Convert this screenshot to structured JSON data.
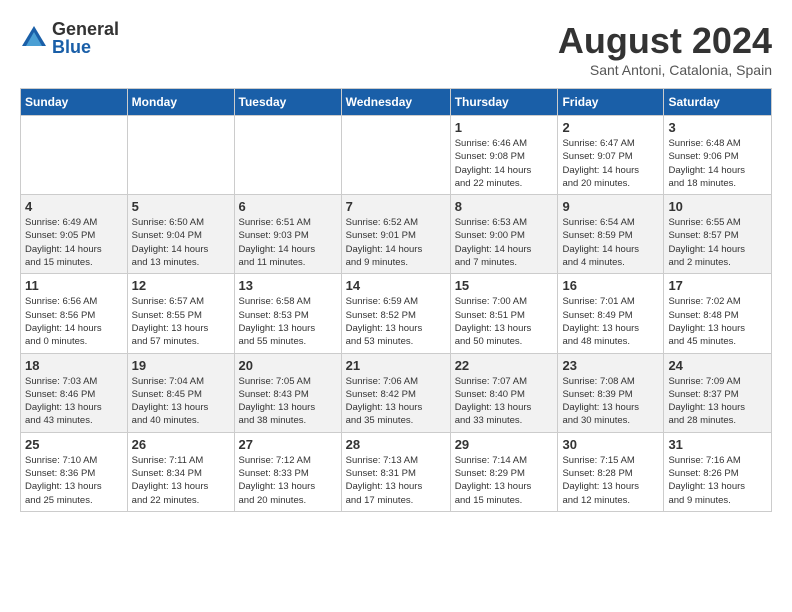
{
  "logo": {
    "general": "General",
    "blue": "Blue"
  },
  "header": {
    "month_year": "August 2024",
    "location": "Sant Antoni, Catalonia, Spain"
  },
  "weekdays": [
    "Sunday",
    "Monday",
    "Tuesday",
    "Wednesday",
    "Thursday",
    "Friday",
    "Saturday"
  ],
  "weeks": [
    [
      {
        "day": "",
        "info": ""
      },
      {
        "day": "",
        "info": ""
      },
      {
        "day": "",
        "info": ""
      },
      {
        "day": "",
        "info": ""
      },
      {
        "day": "1",
        "info": "Sunrise: 6:46 AM\nSunset: 9:08 PM\nDaylight: 14 hours\nand 22 minutes."
      },
      {
        "day": "2",
        "info": "Sunrise: 6:47 AM\nSunset: 9:07 PM\nDaylight: 14 hours\nand 20 minutes."
      },
      {
        "day": "3",
        "info": "Sunrise: 6:48 AM\nSunset: 9:06 PM\nDaylight: 14 hours\nand 18 minutes."
      }
    ],
    [
      {
        "day": "4",
        "info": "Sunrise: 6:49 AM\nSunset: 9:05 PM\nDaylight: 14 hours\nand 15 minutes."
      },
      {
        "day": "5",
        "info": "Sunrise: 6:50 AM\nSunset: 9:04 PM\nDaylight: 14 hours\nand 13 minutes."
      },
      {
        "day": "6",
        "info": "Sunrise: 6:51 AM\nSunset: 9:03 PM\nDaylight: 14 hours\nand 11 minutes."
      },
      {
        "day": "7",
        "info": "Sunrise: 6:52 AM\nSunset: 9:01 PM\nDaylight: 14 hours\nand 9 minutes."
      },
      {
        "day": "8",
        "info": "Sunrise: 6:53 AM\nSunset: 9:00 PM\nDaylight: 14 hours\nand 7 minutes."
      },
      {
        "day": "9",
        "info": "Sunrise: 6:54 AM\nSunset: 8:59 PM\nDaylight: 14 hours\nand 4 minutes."
      },
      {
        "day": "10",
        "info": "Sunrise: 6:55 AM\nSunset: 8:57 PM\nDaylight: 14 hours\nand 2 minutes."
      }
    ],
    [
      {
        "day": "11",
        "info": "Sunrise: 6:56 AM\nSunset: 8:56 PM\nDaylight: 14 hours\nand 0 minutes."
      },
      {
        "day": "12",
        "info": "Sunrise: 6:57 AM\nSunset: 8:55 PM\nDaylight: 13 hours\nand 57 minutes."
      },
      {
        "day": "13",
        "info": "Sunrise: 6:58 AM\nSunset: 8:53 PM\nDaylight: 13 hours\nand 55 minutes."
      },
      {
        "day": "14",
        "info": "Sunrise: 6:59 AM\nSunset: 8:52 PM\nDaylight: 13 hours\nand 53 minutes."
      },
      {
        "day": "15",
        "info": "Sunrise: 7:00 AM\nSunset: 8:51 PM\nDaylight: 13 hours\nand 50 minutes."
      },
      {
        "day": "16",
        "info": "Sunrise: 7:01 AM\nSunset: 8:49 PM\nDaylight: 13 hours\nand 48 minutes."
      },
      {
        "day": "17",
        "info": "Sunrise: 7:02 AM\nSunset: 8:48 PM\nDaylight: 13 hours\nand 45 minutes."
      }
    ],
    [
      {
        "day": "18",
        "info": "Sunrise: 7:03 AM\nSunset: 8:46 PM\nDaylight: 13 hours\nand 43 minutes."
      },
      {
        "day": "19",
        "info": "Sunrise: 7:04 AM\nSunset: 8:45 PM\nDaylight: 13 hours\nand 40 minutes."
      },
      {
        "day": "20",
        "info": "Sunrise: 7:05 AM\nSunset: 8:43 PM\nDaylight: 13 hours\nand 38 minutes."
      },
      {
        "day": "21",
        "info": "Sunrise: 7:06 AM\nSunset: 8:42 PM\nDaylight: 13 hours\nand 35 minutes."
      },
      {
        "day": "22",
        "info": "Sunrise: 7:07 AM\nSunset: 8:40 PM\nDaylight: 13 hours\nand 33 minutes."
      },
      {
        "day": "23",
        "info": "Sunrise: 7:08 AM\nSunset: 8:39 PM\nDaylight: 13 hours\nand 30 minutes."
      },
      {
        "day": "24",
        "info": "Sunrise: 7:09 AM\nSunset: 8:37 PM\nDaylight: 13 hours\nand 28 minutes."
      }
    ],
    [
      {
        "day": "25",
        "info": "Sunrise: 7:10 AM\nSunset: 8:36 PM\nDaylight: 13 hours\nand 25 minutes."
      },
      {
        "day": "26",
        "info": "Sunrise: 7:11 AM\nSunset: 8:34 PM\nDaylight: 13 hours\nand 22 minutes."
      },
      {
        "day": "27",
        "info": "Sunrise: 7:12 AM\nSunset: 8:33 PM\nDaylight: 13 hours\nand 20 minutes."
      },
      {
        "day": "28",
        "info": "Sunrise: 7:13 AM\nSunset: 8:31 PM\nDaylight: 13 hours\nand 17 minutes."
      },
      {
        "day": "29",
        "info": "Sunrise: 7:14 AM\nSunset: 8:29 PM\nDaylight: 13 hours\nand 15 minutes."
      },
      {
        "day": "30",
        "info": "Sunrise: 7:15 AM\nSunset: 8:28 PM\nDaylight: 13 hours\nand 12 minutes."
      },
      {
        "day": "31",
        "info": "Sunrise: 7:16 AM\nSunset: 8:26 PM\nDaylight: 13 hours\nand 9 minutes."
      }
    ]
  ]
}
